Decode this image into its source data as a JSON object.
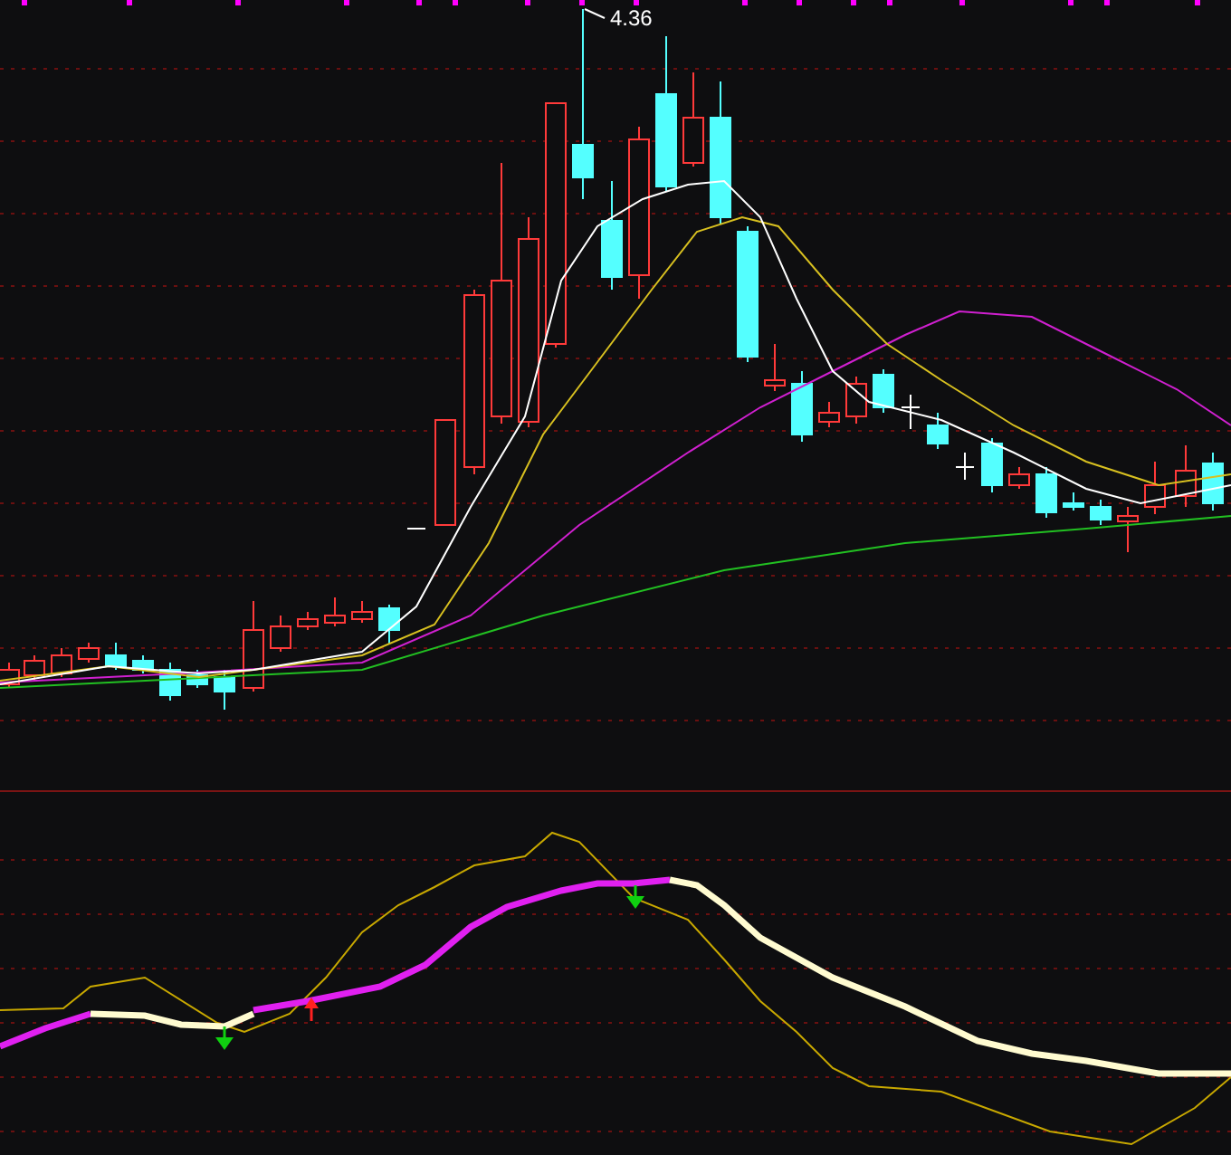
{
  "price_chart": {
    "high_label": "4.36"
  }
}
